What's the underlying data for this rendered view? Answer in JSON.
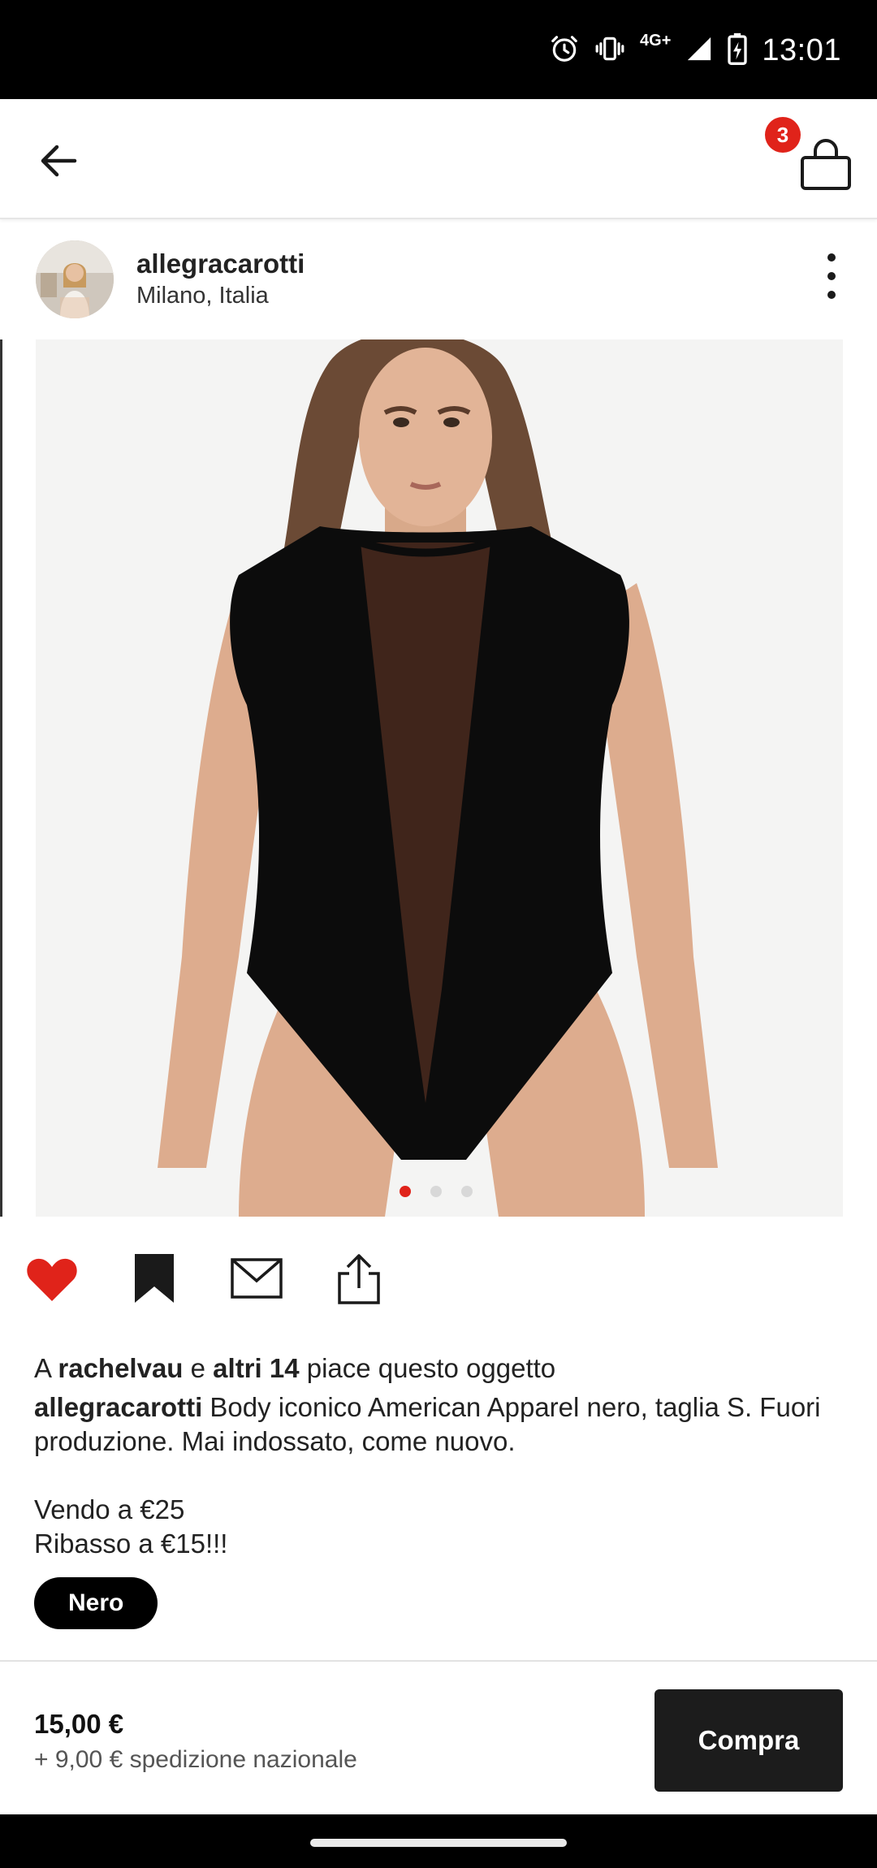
{
  "status_bar": {
    "time": "13:01",
    "network": "4G+",
    "icons": [
      "alarm-icon",
      "vibrate-icon",
      "signal-icon",
      "battery-charging-icon"
    ]
  },
  "app_bar": {
    "back_icon": "arrow-left-icon",
    "cart_icon": "shopping-bag-icon",
    "cart_count": "3"
  },
  "post": {
    "username": "allegracarotti",
    "location": "Milano, Italia",
    "more_icon": "more-vertical-icon",
    "image_description_alt": "Body nero American Apparel",
    "carousel": {
      "count": 3,
      "active_index": 0
    }
  },
  "actions": {
    "like_icon": "heart-filled-icon",
    "save_icon": "bookmark-filled-icon",
    "message_icon": "mail-icon",
    "share_icon": "share-icon",
    "like_color": "#e0231a"
  },
  "caption": {
    "likes_prefix": "A",
    "likes_user": "rachelvau",
    "likes_mid": "e",
    "likes_others": "altri 14",
    "likes_suffix": "piace questo oggetto",
    "author": "allegracarotti",
    "text": "Body iconico American Apparel nero, taglia S. Fuori produzione. Mai indossato, come nuovo.",
    "price_line_1": "Vendo a €25",
    "price_line_2": "Ribasso a €15!!!"
  },
  "tag": {
    "label": "Nero"
  },
  "purchase": {
    "price": "15,00 €",
    "shipping": "+ 9,00 € spedizione nazionale",
    "buy_label": "Compra"
  }
}
